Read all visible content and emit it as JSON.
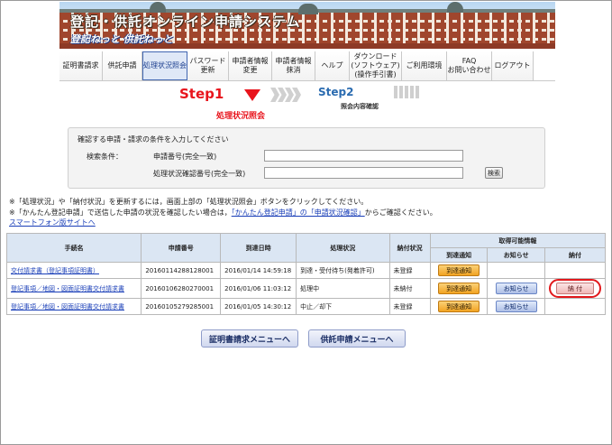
{
  "header": {
    "title": "登記・供託オンライン申請システム",
    "subtitle": "登記ねっと 供託ねっと"
  },
  "nav": {
    "items": [
      {
        "label": "証明書請求",
        "active": false
      },
      {
        "label": "供託申請",
        "active": false
      },
      {
        "label": "処理状況照会",
        "active": true
      },
      {
        "label": "パスワード\n更新",
        "active": false
      },
      {
        "label": "申請者情報\n変更",
        "active": false
      },
      {
        "label": "申請者情報\n抹消",
        "active": false
      },
      {
        "label": "ヘルプ",
        "active": false
      },
      {
        "label": "ダウンロード\n(ソフトウェア)\n(操作手引書)",
        "active": false
      },
      {
        "label": "ご利用環境",
        "active": false
      },
      {
        "label": "FAQ\nお問い合わせ",
        "active": false
      },
      {
        "label": "ログアウト",
        "active": false
      }
    ]
  },
  "steps": {
    "step1_label": "Step1",
    "step1_caption": "処理状況照会",
    "step2_label": "Step2",
    "step2_caption": "照会内容確認"
  },
  "search": {
    "instruction": "確認する申請・請求の条件を入力してください",
    "conditions_label": "検索条件：",
    "application_number_label": "申請番号(完全一致)",
    "application_number_value": "",
    "status_number_label": "処理状況確認番号(完全一致)",
    "status_number_value": "",
    "search_button": "検索"
  },
  "notes": {
    "line1": "※「処理状況」や「納付状況」を更新するには，画面上部の「処理状況照会」ボタンをクリックしてください。",
    "line2_pre": "※「かんたん登記申請」で送信した申請の状況を確認したい場合は，",
    "line2_link": "「かんたん登記申請」の「申請状況確認」",
    "line2_post": "からご確認ください。",
    "mobile_link": "スマートフォン版サイトへ"
  },
  "table": {
    "headers": {
      "procedure": "手続名",
      "application_no": "申請番号",
      "arrival_datetime": "到達日時",
      "status": "処理状況",
      "payment_status": "納付状況",
      "obtainable_info": "取得可能情報",
      "arrival_notice": "到達通知",
      "notice": "お知らせ",
      "payment": "納付"
    },
    "rows": [
      {
        "procedure": "交付請求書（登記事項証明書）",
        "application_no": "20160114288128001",
        "arrival_datetime": "2016/01/14 14:59:18",
        "status": "到達・受付待ち(発着許可)",
        "payment_status": "未登録",
        "arrival_notice_btn": "到達通知",
        "notice_btn": "",
        "payment_btn": ""
      },
      {
        "procedure": "登記事項／地図・図面証明書交付請求書",
        "application_no": "20160106280270001",
        "arrival_datetime": "2016/01/06 11:03:12",
        "status": "処理中",
        "payment_status": "未納付",
        "arrival_notice_btn": "到達通知",
        "notice_btn": "お知らせ",
        "payment_btn": "納 付"
      },
      {
        "procedure": "登記事項／地図・図面証明書交付請求書",
        "application_no": "20160105279285001",
        "arrival_datetime": "2016/01/05 14:30:12",
        "status": "中止／却下",
        "payment_status": "未登録",
        "arrival_notice_btn": "到達通知",
        "notice_btn": "お知らせ",
        "payment_btn": ""
      }
    ]
  },
  "bottom_buttons": {
    "certificate_menu": "証明書請求メニューへ",
    "deposit_menu": "供託申請メニューへ"
  },
  "colors": {
    "step_red": "#e8141c",
    "step_blue": "#2a6bb0",
    "link_blue": "#1a3fb8",
    "table_header": "#dbe6f3",
    "arrival_button": "#f2a422",
    "notice_button": "#aebfe6",
    "highlight_ring": "#e2181c"
  }
}
